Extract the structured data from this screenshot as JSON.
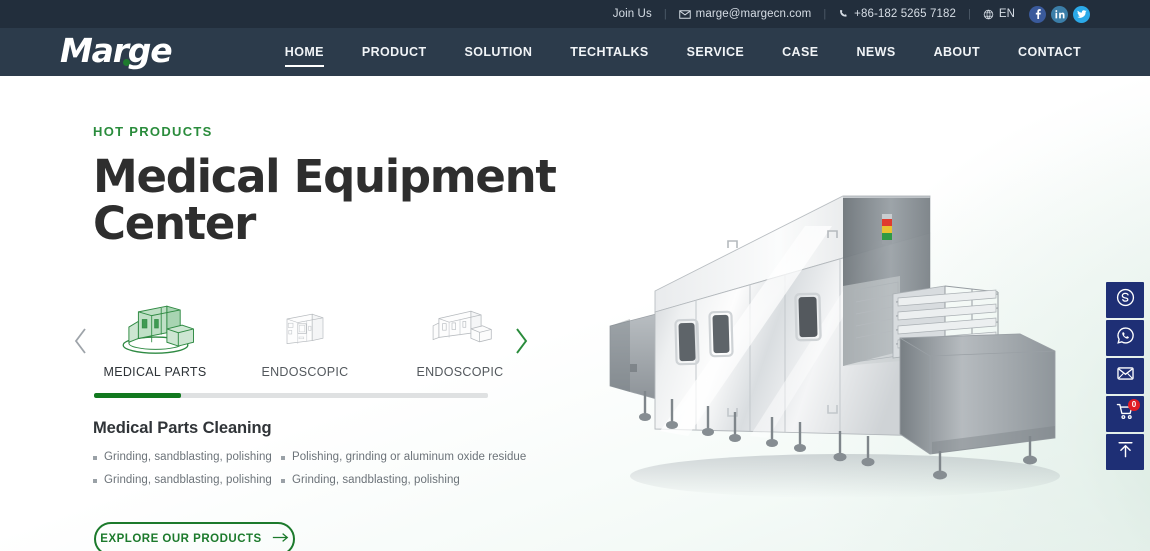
{
  "topbar": {
    "join_label": "Join Us",
    "email": "marge@margecn.com",
    "phone": "+86-182 5265 7182",
    "language": "EN",
    "socials": [
      {
        "name": "facebook-icon",
        "label": "Facebook",
        "color": "#3a5a9b"
      },
      {
        "name": "linkedin-icon",
        "label": "LinkedIn",
        "color": "#3b7ea8"
      },
      {
        "name": "twitter-icon",
        "label": "Twitter",
        "color": "#2ba9e8"
      }
    ]
  },
  "brand": {
    "name": "Marge",
    "accent_color": "#1e7b2e"
  },
  "nav": {
    "items": [
      {
        "label": "HOME",
        "active": true
      },
      {
        "label": "PRODUCT",
        "active": false
      },
      {
        "label": "SOLUTION",
        "active": false
      },
      {
        "label": "TECHTALKS",
        "active": false
      },
      {
        "label": "SERVICE",
        "active": false
      },
      {
        "label": "CASE",
        "active": false
      },
      {
        "label": "NEWS",
        "active": false
      },
      {
        "label": "ABOUT",
        "active": false
      },
      {
        "label": "CONTACT",
        "active": false
      }
    ]
  },
  "hero": {
    "eyebrow": "HOT PRODUCTS",
    "title": "Medical Equipment Center",
    "accent_color": "#2a8c3c"
  },
  "carousel": {
    "prev_label": "Previous",
    "next_label": "Next",
    "progress_percent": 22,
    "items": [
      {
        "label": "MEDICAL PARTS",
        "active": true
      },
      {
        "label": "ENDOSCOPIC",
        "active": false
      },
      {
        "label": "ENDOSCOPIC",
        "active": false
      }
    ]
  },
  "specs": {
    "heading": "Medical Parts Cleaning",
    "items": [
      "Grinding, sandblasting, polishing",
      "Polishing, grinding or aluminum oxide residue",
      "Grinding, sandblasting, polishing",
      "Grinding, sandblasting, polishing"
    ]
  },
  "cta": {
    "label": "EXPLORE OUR PRODUCTS"
  },
  "rail": {
    "buttons": [
      {
        "name": "skype-icon",
        "label": "Skype",
        "badge": null
      },
      {
        "name": "whatsapp-icon",
        "label": "WhatsApp",
        "badge": null
      },
      {
        "name": "email-icon",
        "label": "Email",
        "badge": null
      },
      {
        "name": "cart-icon",
        "label": "Cart",
        "badge": "0"
      },
      {
        "name": "back-to-top-icon",
        "label": "Back to top",
        "badge": null
      }
    ],
    "badge_color": "#e01b24",
    "background_color": "#1e2f75"
  },
  "product_image": {
    "alt": "Industrial tunnel washing machine"
  }
}
